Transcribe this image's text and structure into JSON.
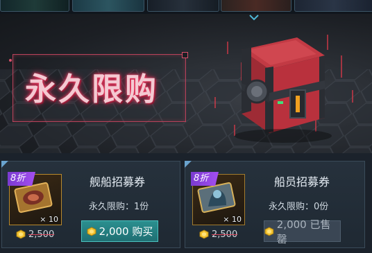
{
  "top_strip": {
    "thumbnails": [
      "thumb-1",
      "thumb-2",
      "thumb-3",
      "thumb-4",
      "thumb-5"
    ]
  },
  "banner": {
    "title": "永久限购",
    "colors": {
      "title_glow": "#ff4d73",
      "frame": "#b8425a"
    }
  },
  "cards": [
    {
      "badge": "8折",
      "quantity": "× 10",
      "name": "舰船招募券",
      "limit": "永久限购：1份",
      "original_price": "2,500",
      "button": "2,000 购买",
      "status": "available"
    },
    {
      "badge": "8折",
      "quantity": "× 10",
      "name": "船员招募券",
      "limit": "永久限购：0份",
      "original_price": "2,500",
      "button": "2,000 已售罄",
      "status": "sold-out"
    }
  ],
  "icons": {
    "currency": "gold-coin-icon",
    "expand": "chevron-down-icon"
  },
  "colors": {
    "buy_button": "#2b8f8f",
    "sold_button": "#3a4654",
    "badge": "#a44ef0"
  }
}
